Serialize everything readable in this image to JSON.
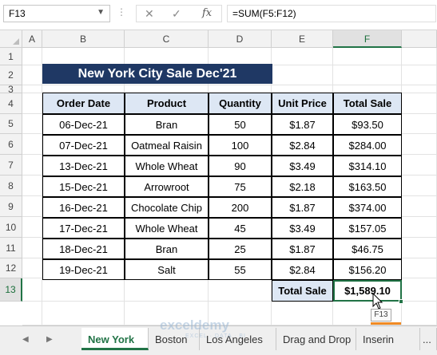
{
  "formula_bar": {
    "name_box": "F13",
    "cancel_icon": "close-icon",
    "enter_icon": "check-icon",
    "function_icon": "fx",
    "formula": "=SUM(F5:F12)"
  },
  "grid": {
    "columns": [
      "A",
      "B",
      "C",
      "D",
      "E",
      "F"
    ],
    "rows": [
      "1",
      "2",
      "3",
      "4",
      "5",
      "6",
      "7",
      "8",
      "9",
      "10",
      "11",
      "12",
      "13"
    ],
    "active_column": "F",
    "active_row": "13"
  },
  "sheet": {
    "title": "New York City Sale Dec'21",
    "table": {
      "headers": [
        "Order Date",
        "Product",
        "Quantity",
        "Unit Price",
        "Total Sale"
      ],
      "rows": [
        [
          "06-Dec-21",
          "Bran",
          "50",
          "$1.87",
          "$93.50"
        ],
        [
          "07-Dec-21",
          "Oatmeal Raisin",
          "100",
          "$2.84",
          "$284.00"
        ],
        [
          "13-Dec-21",
          "Whole Wheat",
          "90",
          "$3.49",
          "$314.10"
        ],
        [
          "15-Dec-21",
          "Arrowroot",
          "75",
          "$2.18",
          "$163.50"
        ],
        [
          "16-Dec-21",
          "Chocolate Chip",
          "200",
          "$1.87",
          "$374.00"
        ],
        [
          "17-Dec-21",
          "Whole Wheat",
          "45",
          "$3.49",
          "$157.05"
        ],
        [
          "18-Dec-21",
          "Bran",
          "25",
          "$1.87",
          "$46.75"
        ],
        [
          "19-Dec-21",
          "Salt",
          "55",
          "$2.84",
          "$156.20"
        ]
      ],
      "total_label": "Total Sale",
      "total_value": "$1,589.10"
    },
    "cell_tooltip": "F13"
  },
  "tabs": {
    "items": [
      "New York",
      "Boston",
      "Los Angeles",
      "Drag and Drop",
      "Inserin"
    ],
    "active": "New York",
    "overflow": "..."
  },
  "watermark": {
    "brand": "exceldemy",
    "tagline": "EXCEL · DATA · BI"
  },
  "colors": {
    "title_bg": "#1f3864",
    "header_bg": "#dde7f4",
    "accent": "#217346",
    "tooltip_underline": "#f08a24"
  }
}
